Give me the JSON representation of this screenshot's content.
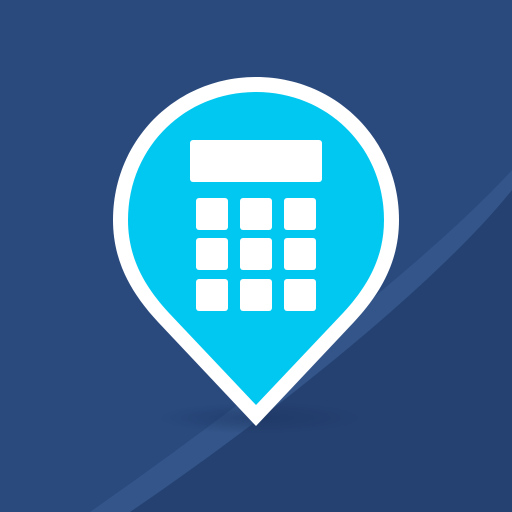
{
  "icon": {
    "name": "calculator-location-pin-icon",
    "colors": {
      "background": "#2a4a7e",
      "background_dark": "#243f6f",
      "background_sheen": "#3a5f92",
      "pin_outline": "#ffffff",
      "pin_fill": "#00c8f0",
      "keypad": "#ffffff",
      "shadow": "#1b3360"
    }
  }
}
